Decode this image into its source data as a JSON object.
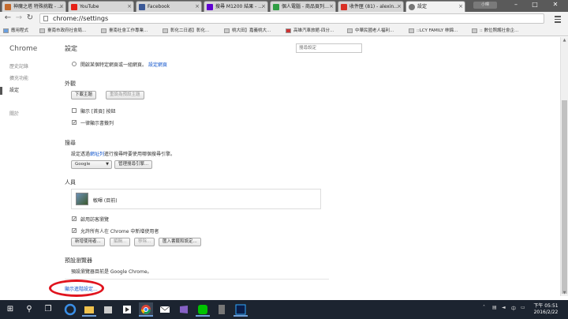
{
  "tabs": [
    {
      "title": "神魔之塔 特殊挑戰 - …"
    },
    {
      "title": "YouTube"
    },
    {
      "title": "Facebook"
    },
    {
      "title": "搜尋 M1200 結果 - …"
    },
    {
      "title": "個人電腦 - 商品頁列…"
    },
    {
      "title": "收件匣 (81) - alexin…"
    },
    {
      "title": "設定"
    }
  ],
  "window": {
    "user_label": "小暉",
    "minimize": "–",
    "maximize": "□",
    "close": "✕"
  },
  "toolbar": {
    "url": "chrome://settings"
  },
  "bookmarks": [
    {
      "label": "應用程式"
    },
    {
      "label": "臺南市政府社會局..."
    },
    {
      "label": "臺南社會工作專業..."
    },
    {
      "label": "彰化二日遊】彰化..."
    },
    {
      "label": "桃大田】嘉義桃大..."
    },
    {
      "label": "高雄汽車旅館-四分..."
    },
    {
      "label": "中華民國老人福利..."
    },
    {
      "label": "::LCY FAMILY 林錦..."
    },
    {
      "label": ":: 數位照護社會企..."
    }
  ],
  "sidebar": {
    "brand": "Chrome",
    "items": [
      {
        "label": "歷史記錄"
      },
      {
        "label": "擴充功能"
      },
      {
        "label": "設定"
      },
      {
        "label": "關於"
      }
    ]
  },
  "settings": {
    "title": "設定",
    "search_placeholder": "搜尋設定",
    "startup": {
      "option": "開啟某個特定網頁或一組網頁。",
      "link": "設定網頁"
    },
    "appearance": {
      "title": "外觀",
      "themes_button": "下載主題",
      "reset_button": "重設為預設主題",
      "home_button": "顯示 [首頁] 按鈕",
      "bookmarks_bar": "一律顯示書籤列"
    },
    "search": {
      "title": "搜尋",
      "desc_before": "設定透過",
      "desc_link": "網址列",
      "desc_after": "進行搜尋時要使用哪個搜尋引擎。",
      "engine": "Google",
      "manage_button": "管理搜尋引擎..."
    },
    "people": {
      "title": "人員",
      "current_user": "敏暉 (目前)",
      "guest_browsing": "啟用訪客瀏覽",
      "let_anyone_add": "允許所有人在 Chrome 中新增使用者",
      "add_button": "新增使用者...",
      "edit_button": "編輯...",
      "remove_button": "移除...",
      "import_button": "匯入書籤和設定..."
    },
    "default_browser": {
      "title": "預設瀏覽器",
      "text": "預設瀏覽器目前是 Google Chrome。"
    },
    "advanced_link": "顯示進階設定..."
  },
  "taskbar": {
    "time": "下午 05:51",
    "date": "2016/2/22",
    "apps": [
      "search-icon",
      "task-view-icon",
      "edge-icon",
      "file-explorer-icon",
      "store-icon",
      "media-icon",
      "chrome-icon",
      "mail-icon",
      "visual-studio-icon",
      "line-icon",
      "calculator-icon",
      "photoshop-icon"
    ]
  }
}
